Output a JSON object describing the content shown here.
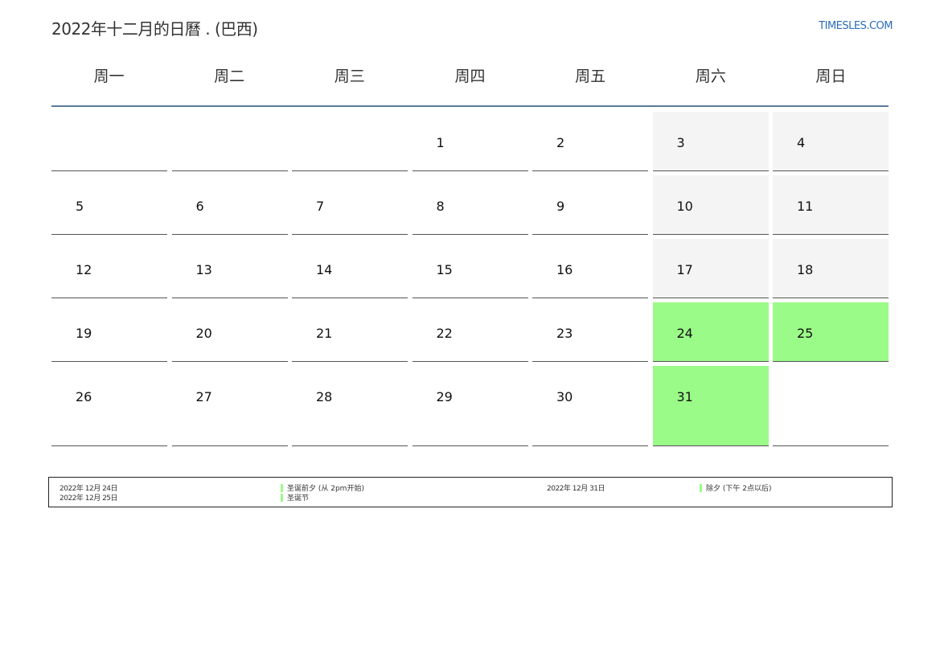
{
  "header": {
    "title": "2022年十二月的日曆 . (巴西)",
    "brand": "TIMESLES.COM"
  },
  "colors": {
    "holiday": "#9bfb88",
    "weekend": "#f4f4f4",
    "header_rule": "#5a7b9c",
    "brand": "#2a6ebb"
  },
  "weekdays": [
    "周一",
    "周二",
    "周三",
    "周四",
    "周五",
    "周六",
    "周日"
  ],
  "weeks": [
    [
      "",
      "",
      "",
      "1",
      "2",
      "3",
      "4"
    ],
    [
      "5",
      "6",
      "7",
      "8",
      "9",
      "10",
      "11"
    ],
    [
      "12",
      "13",
      "14",
      "15",
      "16",
      "17",
      "18"
    ],
    [
      "19",
      "20",
      "21",
      "22",
      "23",
      "24",
      "25"
    ],
    [
      "26",
      "27",
      "28",
      "29",
      "30",
      "31",
      ""
    ]
  ],
  "holidays_days": [
    "24",
    "25",
    "31"
  ],
  "legend": [
    {
      "date": "2022年 12月 24日",
      "name": "圣诞前夕 (从 2pm开始)"
    },
    {
      "date": "2022年 12月 25日",
      "name": "圣诞节"
    },
    {
      "date": "2022年 12月 31日",
      "name": "除夕 (下午 2点以后)"
    }
  ]
}
